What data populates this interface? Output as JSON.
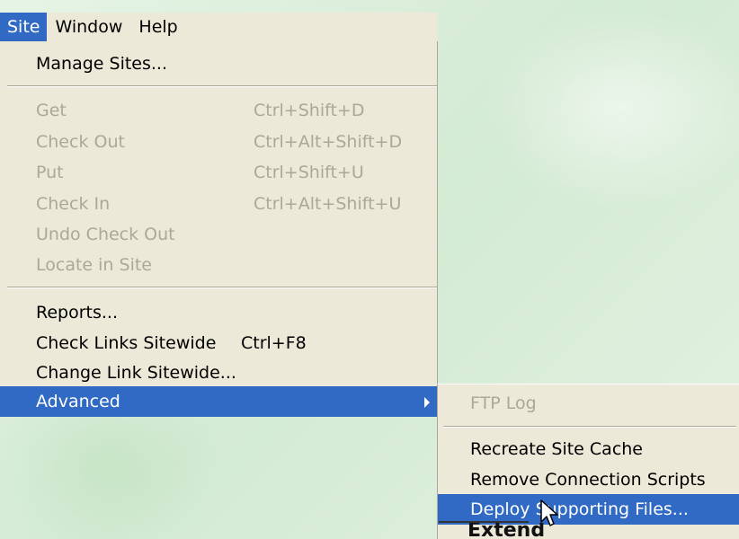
{
  "menubar": {
    "items": [
      {
        "label": "Site"
      },
      {
        "label": "Window"
      },
      {
        "label": "Help"
      }
    ]
  },
  "site_menu": {
    "manage_sites": "Manage Sites...",
    "get": {
      "label": "Get",
      "shortcut": "Ctrl+Shift+D"
    },
    "check_out": {
      "label": "Check Out",
      "shortcut": "Ctrl+Alt+Shift+D"
    },
    "put": {
      "label": "Put",
      "shortcut": "Ctrl+Shift+U"
    },
    "check_in": {
      "label": "Check In",
      "shortcut": "Ctrl+Alt+Shift+U"
    },
    "undo_check_out": "Undo Check Out",
    "locate_in_site": "Locate in Site",
    "reports": "Reports...",
    "check_links": {
      "label": "Check Links Sitewide",
      "shortcut": "Ctrl+F8"
    },
    "change_link": "Change Link Sitewide...",
    "advanced": "Advanced"
  },
  "advanced_submenu": {
    "ftp_log": "FTP Log",
    "recreate_cache": "Recreate Site Cache",
    "remove_scripts": "Remove Connection Scripts",
    "deploy_files": "Deploy Supporting Files..."
  },
  "background_text": "Extend",
  "colors": {
    "menu_bg": "#ece9d8",
    "highlight": "#316ac5",
    "disabled_text": "#aca899",
    "page_bg": "#dcefdc"
  },
  "icons": {
    "submenu_arrow": "chevron-right-icon",
    "cursor": "mouse-pointer-icon"
  }
}
